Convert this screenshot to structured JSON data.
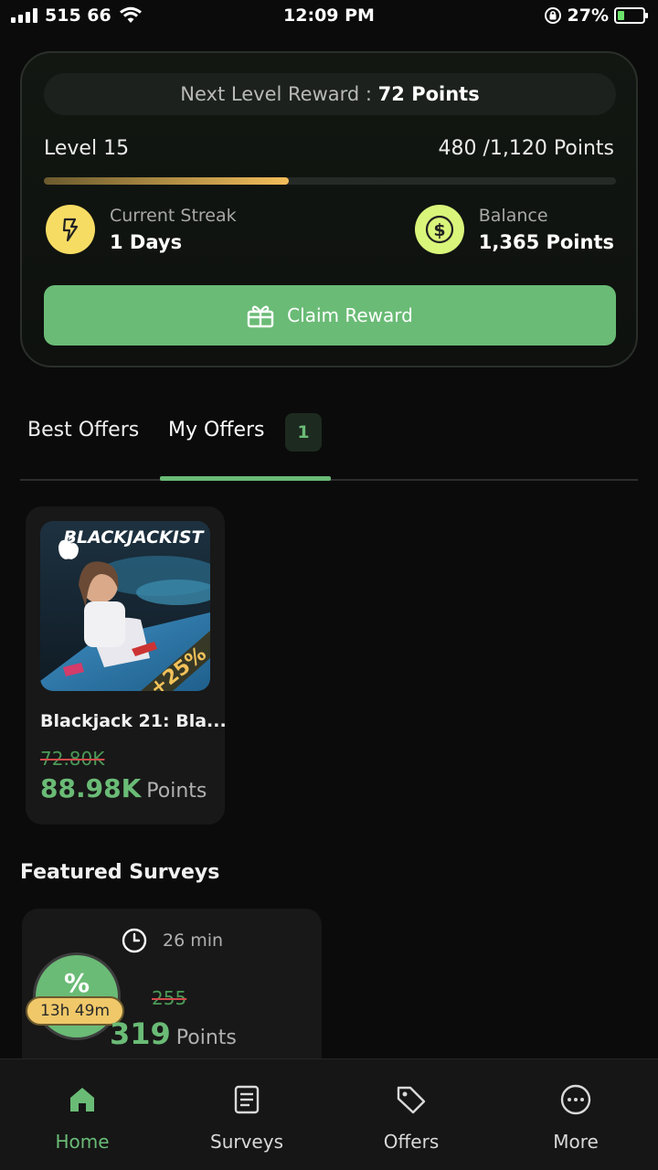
{
  "status_bar": {
    "carrier": "515 66",
    "time": "12:09 PM",
    "battery": "27%",
    "battery_level": 0.27
  },
  "level_card": {
    "next_reward_prefix": "Next Level Reward :",
    "next_reward_value": "72 Points",
    "level": "Level 15",
    "points_progress": "480 /1,120 Points",
    "progress_fraction": 0.4286,
    "streak_caption": "Current Streak",
    "streak_value": "1 Days",
    "balance_caption": "Balance",
    "balance_value": "1,365 Points",
    "claim_label": "Claim Reward"
  },
  "tabs": {
    "best": "Best Offers",
    "mine": "My Offers",
    "mine_count": "1"
  },
  "offer": {
    "image_title": "BLACKJACKIST",
    "image_badge": "+25%",
    "title": "Blackjack 21: Bla...",
    "old_points": "72.80K",
    "new_points": "88.98K",
    "unit": "Points"
  },
  "featured": {
    "title": "Featured Surveys",
    "survey": {
      "percent_symbol": "%",
      "timer": "13h 49m",
      "duration": "26 min",
      "old_points": "255",
      "new_points": "319",
      "unit": "Points"
    }
  },
  "nav": {
    "home": "Home",
    "surveys": "Surveys",
    "offers": "Offers",
    "more": "More"
  },
  "colors": {
    "accent": "#6abb76",
    "streak": "#f7dc64",
    "balance": "#d9f57a",
    "progress": "#f2be5a"
  }
}
